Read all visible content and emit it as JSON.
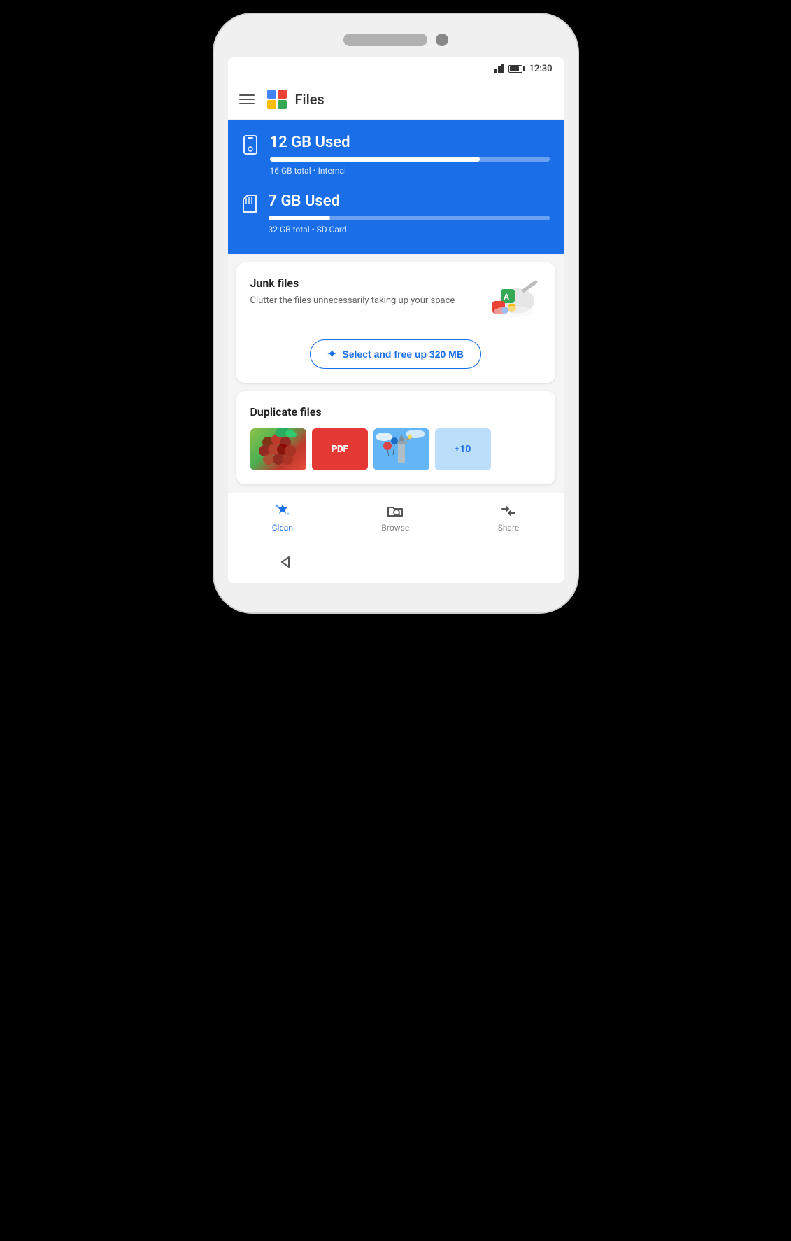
{
  "phone": {
    "status_bar": {
      "time": "12:30"
    },
    "app_header": {
      "title": "Files"
    },
    "storage": {
      "internal": {
        "used_label": "12 GB Used",
        "bar_pct": 75,
        "info_label": "16 GB total • Internal"
      },
      "sd_card": {
        "used_label": "7 GB Used",
        "bar_pct": 22,
        "info_label": "32 GB total • SD Card"
      }
    },
    "junk_card": {
      "title": "Junk files",
      "description": "Clutter the files unnecessarily taking up your space",
      "action_label": "Select and free up 320 MB"
    },
    "duplicate_card": {
      "title": "Duplicate files",
      "more_count": "+10"
    },
    "bottom_nav": {
      "items": [
        {
          "label": "Clean",
          "active": true
        },
        {
          "label": "Browse",
          "active": false
        },
        {
          "label": "Share",
          "active": false
        }
      ]
    }
  }
}
